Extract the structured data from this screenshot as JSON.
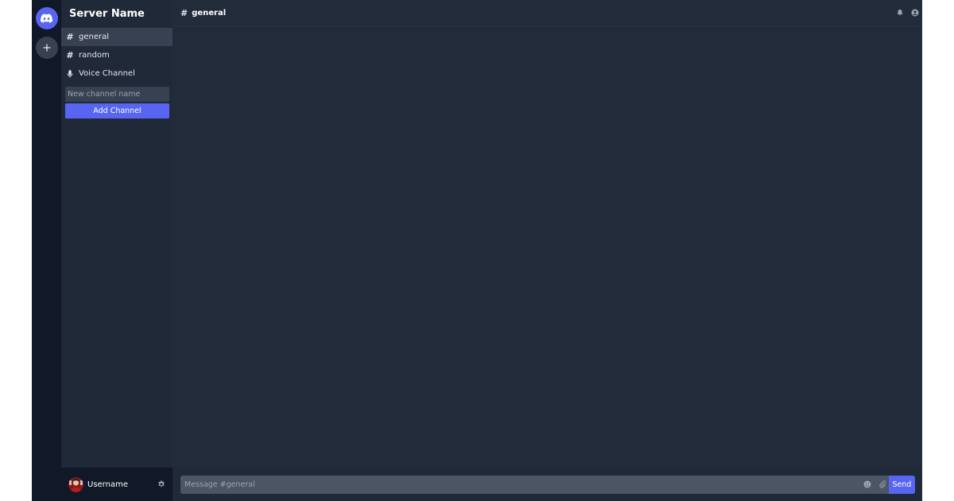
{
  "sidebar": {
    "server_name": "Server Name",
    "channels": [
      {
        "label": "general",
        "icon": "hash-icon",
        "active": true
      },
      {
        "label": "random",
        "icon": "hash-icon",
        "active": false
      },
      {
        "label": "Voice Channel",
        "icon": "microphone-icon",
        "active": false
      }
    ],
    "new_channel_placeholder": "New channel name",
    "add_channel_label": "Add Channel"
  },
  "rail": {
    "home_icon": "discord-icon",
    "add_icon": "plus-icon"
  },
  "user": {
    "username": "Username"
  },
  "header": {
    "channel_name": "general"
  },
  "composer": {
    "placeholder": "Message #general",
    "send_label": "Send"
  },
  "colors": {
    "accent": "#5865f2",
    "rail_bg": "#111827",
    "sidebar_bg": "#1f2937",
    "main_bg": "#222b3a"
  }
}
